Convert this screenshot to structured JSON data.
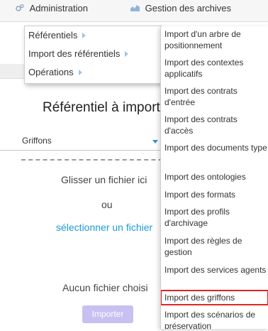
{
  "topbar": {
    "admin_label": "Administration",
    "archives_label": "Gestion des archives"
  },
  "admin_menu": {
    "items": [
      {
        "label": "Référentiels"
      },
      {
        "label": "Import des référentiels"
      },
      {
        "label": "Opérations"
      }
    ]
  },
  "import_menu": {
    "items": [
      {
        "label": "Import d'un arbre de positionnement"
      },
      {
        "label": "Import des contextes applicatifs"
      },
      {
        "label": "Import des contrats d'entrée"
      },
      {
        "label": "Import des contrats d'accès"
      },
      {
        "label": "Import des documents type"
      },
      {
        "label": "Import des ontologies"
      },
      {
        "label": "Import des formats"
      },
      {
        "label": "Import des profils d'archivage"
      },
      {
        "label": "Import des règles de gestion"
      },
      {
        "label": "Import des services agents"
      },
      {
        "label": "Import des griffons"
      },
      {
        "label": "Import des scénarios de préservation"
      }
    ],
    "highlighted": "Import des griffons",
    "highlight_color": "#e02424"
  },
  "page": {
    "title": "Référentiel à importer",
    "select_value": "Griffons",
    "drop_text": "Glisser un fichier ici",
    "or_text": "ou",
    "select_file_link": "sélectionner un fichier",
    "no_file_text": "Aucun fichier choisi",
    "import_button": "Importer"
  },
  "colors": {
    "link": "#1e9ad6",
    "button_disabled": "#c9c0f2",
    "arrow": "#9ec3ea"
  }
}
